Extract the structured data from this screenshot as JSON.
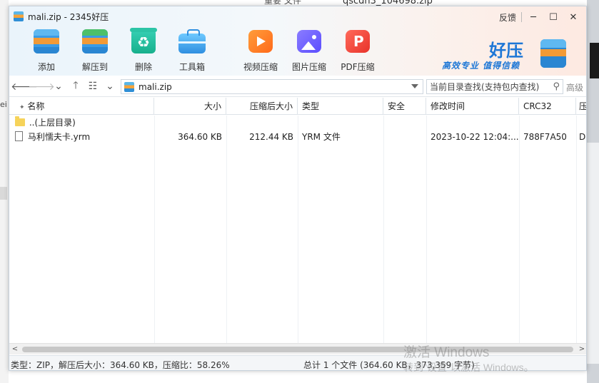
{
  "background": {
    "behind_title": "qscdn3_104698.zip",
    "behind_title2": "重要 文件",
    "left_mark": "ei"
  },
  "window": {
    "title": "mali.zip - 2345好压",
    "controls": {
      "feedback": "反馈",
      "minimize": "─",
      "maximize": "☐",
      "close": "✕"
    }
  },
  "toolbar": {
    "items": [
      {
        "label": "添加",
        "icon": "add-archive-icon"
      },
      {
        "label": "解压到",
        "icon": "extract-icon"
      },
      {
        "label": "删除",
        "icon": "recycle-icon"
      },
      {
        "label": "工具箱",
        "icon": "toolbox-icon"
      },
      {
        "label": "视频压缩",
        "icon": "video-compress-icon"
      },
      {
        "label": "图片压缩",
        "icon": "image-compress-icon"
      },
      {
        "label": "PDF压缩",
        "icon": "pdf-compress-icon"
      }
    ]
  },
  "brand": {
    "name": "好压",
    "slogan": "高效专业 值得信赖"
  },
  "address": {
    "path": "mali.zip",
    "search_placeholder": "当前目录查找(支持包内查找)",
    "advanced": "高级"
  },
  "table": {
    "columns": [
      "名称",
      "大小",
      "压缩后大小",
      "类型",
      "安全",
      "修改时间",
      "CRC32",
      "压"
    ],
    "rows": [
      {
        "name": "..(上层目录)",
        "size": "",
        "packed": "",
        "type": "",
        "security": "",
        "modified": "",
        "crc": "",
        "extra": "",
        "kind": "folder"
      },
      {
        "name": "马利懦夫卡.yrm",
        "size": "364.60 KB",
        "packed": "212.44 KB",
        "type": "YRM 文件",
        "security": "",
        "modified": "2023-10-22 12:04:...",
        "crc": "788F7A50",
        "extra": "De",
        "kind": "file"
      }
    ]
  },
  "status": {
    "left": "类型：ZIP，解压后大小：364.60 KB，压缩比：58.26%",
    "right": "总计 1 个文件 (364.60 KB，373,359 字节)"
  },
  "watermark": {
    "line1": "激活 Windows",
    "line2": "转到\"设置\"以激活 Windows。"
  },
  "colors": {
    "accent": "#1e77d6",
    "header_gradient_start": "#eaf4fb",
    "header_gradient_end": "#fde9e1"
  }
}
